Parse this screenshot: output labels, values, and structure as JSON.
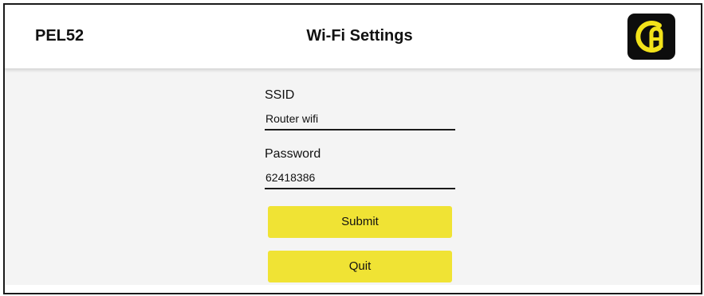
{
  "header": {
    "device_name": "PEL52",
    "title": "Wi-Fi Settings",
    "logo_icon": "ca-logo-icon"
  },
  "form": {
    "ssid_label": "SSID",
    "ssid_value": "Router wifi",
    "password_label": "Password",
    "password_value": "62418386"
  },
  "buttons": {
    "submit_label": "Submit",
    "quit_label": "Quit"
  },
  "colors": {
    "accent": "#f0e334",
    "logo_bg": "#0d0d0d",
    "logo_fg": "#f2e21a"
  }
}
